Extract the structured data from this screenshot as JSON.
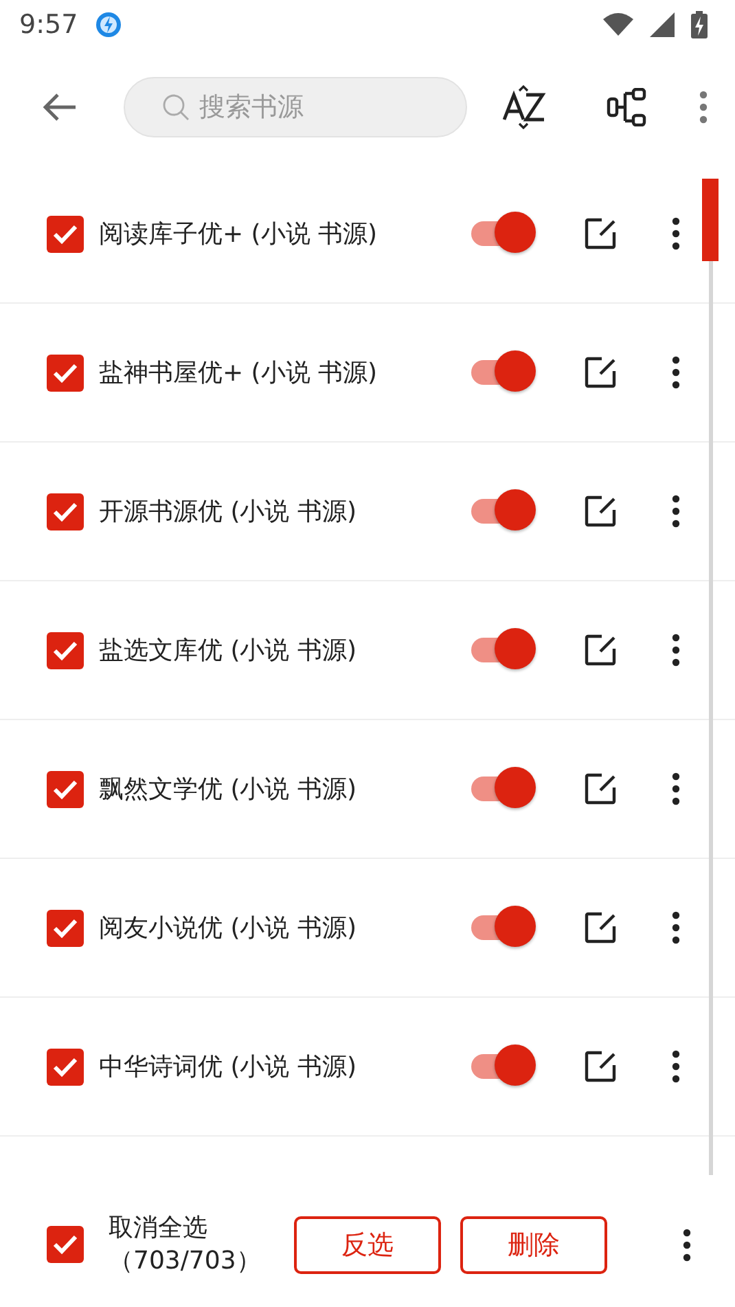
{
  "status_bar": {
    "time": "9:57"
  },
  "toolbar": {
    "search": {
      "placeholder": "搜索书源"
    }
  },
  "sources": [
    {
      "name": "阅读库子优+ (小说 书源)",
      "checked": true,
      "on": true
    },
    {
      "name": "盐神书屋优+ (小说 书源)",
      "checked": true,
      "on": true
    },
    {
      "name": "开源书源优 (小说 书源)",
      "checked": true,
      "on": true
    },
    {
      "name": "盐选文库优 (小说 书源)",
      "checked": true,
      "on": true
    },
    {
      "name": "飘然文学优 (小说 书源)",
      "checked": true,
      "on": true
    },
    {
      "name": "阅友小说优 (小说 书源)",
      "checked": true,
      "on": true
    },
    {
      "name": "中华诗词优 (小说 书源)",
      "checked": true,
      "on": true
    }
  ],
  "bottom_bar": {
    "select_all": {
      "label": "取消全选",
      "count": "（703/703）",
      "checked": true
    },
    "buttons": [
      "反选",
      "删除"
    ]
  }
}
